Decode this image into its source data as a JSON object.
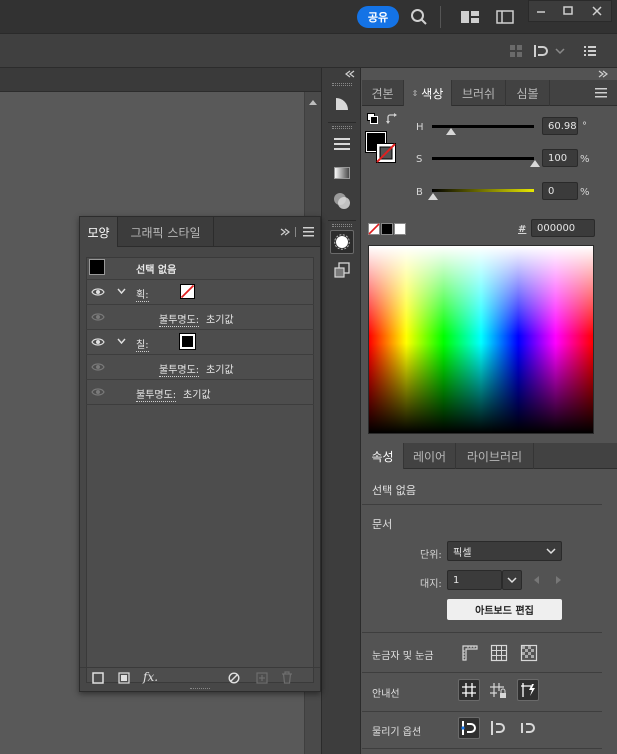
{
  "titlebar": {
    "share_label": "공유",
    "icons": [
      "search-icon",
      "arrange-documents-icon",
      "panel-layout-icon",
      "minimize-icon",
      "maximize-icon",
      "close-icon"
    ]
  },
  "toolbar2": {
    "icons": [
      "align-grid-icon",
      "snap-options-icon",
      "chevron-down-icon",
      "list-icon"
    ]
  },
  "color_panel": {
    "tabs": [
      "견본",
      "색상",
      "브러쉬",
      "심볼"
    ],
    "active_tab": "색상",
    "h_label": "H",
    "h_value": "60.98",
    "h_unit": "°",
    "s_label": "S",
    "s_value": "100",
    "s_unit": "%",
    "b_label": "B",
    "b_value": "0",
    "b_unit": "%",
    "hex_label": "#",
    "hex_value": "000000"
  },
  "properties": {
    "tabs": [
      "속성",
      "레이어",
      "라이브러리"
    ],
    "active_tab": "속성",
    "no_selection": "선택 없음",
    "document_title": "문서",
    "unit_label": "단위:",
    "unit_value": "픽셀",
    "artboard_label": "대지:",
    "artboard_value": "1",
    "edit_artboard_button": "아트보드 편집",
    "rulers_grids": "눈금자 및 눈금",
    "guides": "안내선",
    "snap_options": "물리기 옵션"
  },
  "appearance": {
    "tabs": [
      "모양",
      "그래픽 스타일"
    ],
    "active_tab": "모양",
    "rows": [
      {
        "label": "선택 없음"
      },
      {
        "label": "획:"
      },
      {
        "label_underlined": "불투명도:",
        "value": "초기값"
      },
      {
        "label": "칠:"
      },
      {
        "label_underlined": "불투명도:",
        "value": "초기값"
      },
      {
        "label_underlined": "불투명도:",
        "value": "초기값"
      }
    ],
    "footer_icons": [
      "add-stroke-icon",
      "add-fill-icon",
      "fx-icon",
      "clear-appearance-icon",
      "duplicate-item-icon",
      "trash-icon"
    ],
    "fx_label": "fx."
  },
  "colors": {
    "accent": "#1473e6",
    "panel_bg": "#535353",
    "dark_bg": "#323232"
  }
}
